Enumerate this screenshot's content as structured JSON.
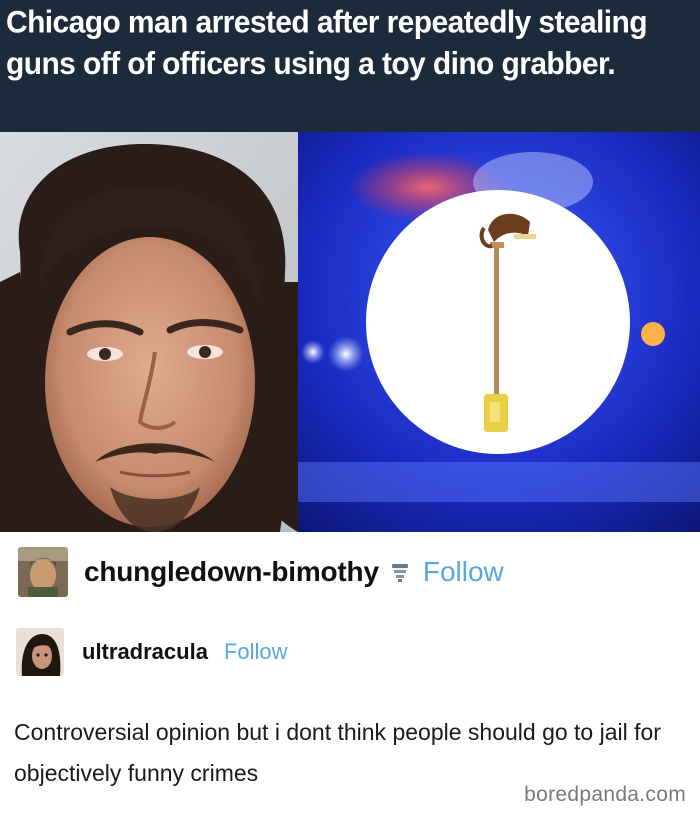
{
  "headline": {
    "text": "Chicago man arrested after repeatedly stealing guns off of officers using a toy dino grabber."
  },
  "images": {
    "mugshot": "mugshot-photo",
    "police": "police-lights-with-dino-grabber"
  },
  "post": {
    "user1": {
      "name": "chungledown-bimothy",
      "badge_icon": "sprinkler-icon",
      "follow_label": "Follow"
    },
    "user2": {
      "name": "ultradracula",
      "follow_label": "Follow"
    },
    "body": "Controversial opinion but i dont think people should go to jail for objectively funny crimes",
    "link_color": "#5aa6df"
  },
  "watermark": "boredpanda.com"
}
